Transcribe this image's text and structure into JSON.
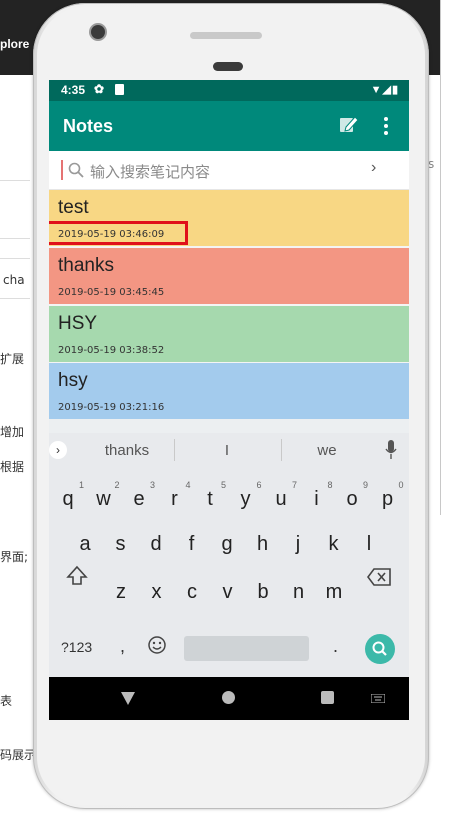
{
  "background": {
    "topbar_text": "plore",
    "left_texts": [
      "cha",
      "扩展",
      "增加",
      "根据",
      "界面;",
      "表",
      "码展示"
    ],
    "tab_hint": "s"
  },
  "status_bar": {
    "time": "4:35",
    "icons": [
      "gear-icon",
      "sd-card-icon",
      "wifi-icon",
      "signal-icon",
      "battery-icon"
    ]
  },
  "app_bar": {
    "title": "Notes",
    "actions": [
      "edit-note-icon",
      "more-vert-icon"
    ]
  },
  "search": {
    "placeholder": "输入搜索笔记内容",
    "go_icon": "chevron-right-icon"
  },
  "notes": [
    {
      "title": "test",
      "date": "2019-05-19 03:46:09",
      "color": "#f8d784",
      "highlighted": true
    },
    {
      "title": "thanks",
      "date": "2019-05-19 03:45:45",
      "color": "#f39683"
    },
    {
      "title": "HSY",
      "date": "2019-05-19 03:38:52",
      "color": "#a6d9ae"
    },
    {
      "title": "hsy",
      "date": "2019-05-19 03:21:16",
      "color": "#a3cbed"
    }
  ],
  "keyboard": {
    "suggestions": [
      "thanks",
      "I",
      "we"
    ],
    "row1": [
      "q",
      "w",
      "e",
      "r",
      "t",
      "y",
      "u",
      "i",
      "o",
      "p"
    ],
    "row1_hints": [
      "1",
      "2",
      "3",
      "4",
      "5",
      "6",
      "7",
      "8",
      "9",
      "0"
    ],
    "row2": [
      "a",
      "s",
      "d",
      "f",
      "g",
      "h",
      "j",
      "k",
      "l"
    ],
    "row3": [
      "z",
      "x",
      "c",
      "v",
      "b",
      "n",
      "m"
    ],
    "symbols_label": "?123",
    "comma": ",",
    "period": ".",
    "accent": "#3cb9a9"
  },
  "colors": {
    "status_bar": "#00695c",
    "app_bar": "#00897b",
    "highlight": "#e0101a"
  }
}
